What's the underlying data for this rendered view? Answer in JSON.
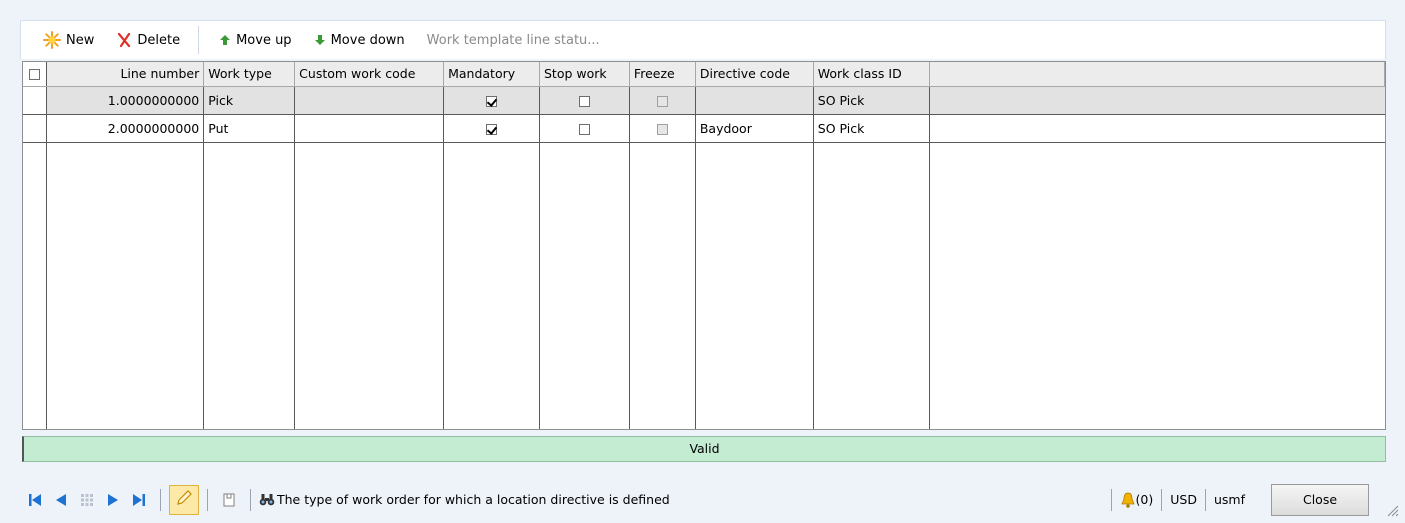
{
  "toolbar": {
    "new_label": "New",
    "delete_label": "Delete",
    "move_up_label": "Move up",
    "move_down_label": "Move down",
    "status_label": "Work template line statu..."
  },
  "grid": {
    "columns": [
      "Line number",
      "Work type",
      "Custom work code",
      "Mandatory",
      "Stop work",
      "Freeze",
      "Directive code",
      "Work class ID"
    ],
    "rows": [
      {
        "line_number": "1.0000000000",
        "work_type": "Pick",
        "custom_work_code": "",
        "mandatory": true,
        "stop_work": false,
        "freeze": false,
        "directive_code": "",
        "work_class_id": "SO Pick"
      },
      {
        "line_number": "2.0000000000",
        "work_type": "Put",
        "custom_work_code": "",
        "mandatory": true,
        "stop_work": false,
        "freeze": false,
        "directive_code": "Baydoor",
        "work_class_id": "SO Pick"
      }
    ]
  },
  "status": {
    "valid_text": "Valid"
  },
  "bottom": {
    "help_text": "The type of work order for which a location directive is defined",
    "alerts": "(0)",
    "currency": "USD",
    "company": "usmf",
    "close_label": "Close"
  },
  "colors": {
    "valid_bg": "#c4ecd2",
    "edit_bg": "#fde9a7",
    "nav_blue": "#1e73d2"
  }
}
